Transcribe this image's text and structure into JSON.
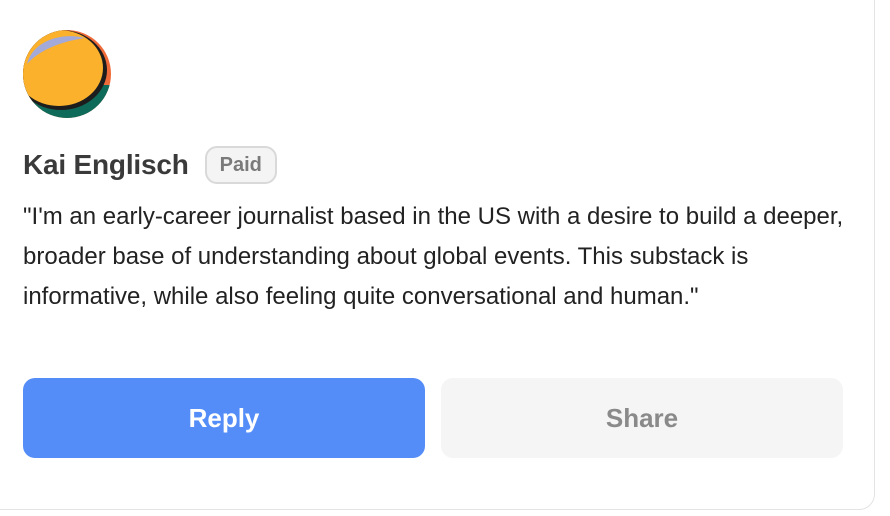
{
  "author": {
    "name": "Kai Englisch",
    "badge": "Paid",
    "avatar_icon": "abstract-gradient-avatar",
    "avatar_colors": [
      "#fbb12c",
      "#f06b3a",
      "#0e6b5a",
      "#a3a9d8",
      "#1d1d1d"
    ]
  },
  "testimonial": {
    "text": "\"I'm an early-career journalist based in the US with a desire to build a deeper, broader base of understanding about global events. This substack is informative, while also feeling quite conversational and human.\""
  },
  "actions": {
    "reply_label": "Reply",
    "share_label": "Share"
  },
  "colors": {
    "reply_bg": "#548df7",
    "share_bg": "#f5f5f5",
    "badge_bg": "#f4f4f4"
  }
}
